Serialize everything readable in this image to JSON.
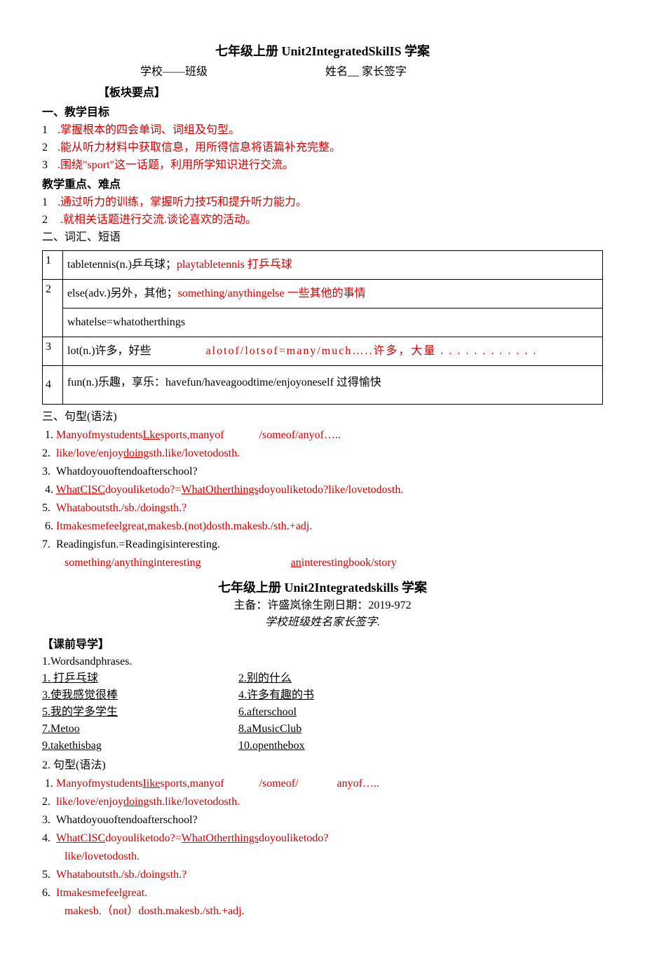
{
  "title1": "七年级上册 Unit2IntegratedSkilIS 学案",
  "header_line_left": "学校——班级",
  "header_line_right": "姓名__ 家长签字",
  "block_label": "【板块要点】",
  "sec1_head": "一、教学目标",
  "sec1_items": {
    "1": ".掌握根本的四会单词、词组及句型。",
    "2": ".能从听力材料中获取信息，用所得信息将语篇补充完整。",
    "3_a": ".围绕\"sport",
    "3_b": "\"这一话题，利用所学知识进行交流。"
  },
  "sec_diff_head": "教学重点、难点",
  "sec_diff_items": {
    "1": ".通过听力的训练，掌握听力技巧和提升听力能力。",
    "2": ".就相关话题进行交流.谈论喜欢的活动。"
  },
  "sec2_head": "二、词汇、短语",
  "vocab": {
    "r1": {
      "n": "1",
      "a": "tabletennis(n.)乒乓球；",
      "b": "playtabletennis 打乒乓球"
    },
    "r2_l1": {
      "n": "2",
      "a": "else(adv.)另外，其他；",
      "b": "something/anythingelse 一些其他的事情"
    },
    "r2_l2": "whatelse=whatotherthings",
    "r3": {
      "n": "3",
      "a": "lot(n.)许多，好些",
      "b": "alotof/lotsof=many/much…..许多，大量 . . . . . . . . . . . ."
    },
    "r4": {
      "n": "4",
      "txt": "fun(n.)乐趣，享乐：havefun/haveagoodtime/enjoyoneself 过得愉快"
    }
  },
  "sec3_head": "三、句型(语法)",
  "gram1": {
    "i1_a": "Manyofmystudents",
    "i1_b": "Lke",
    "i1_c": "sports,manyof",
    "i1_d": "/someof/anyof…..",
    "i2": "like/love/enjoy",
    "i2_u": "doing",
    "i2_c": "sth.like/lovetodosth.",
    "i3": "Whatdoyouoftendoafterschool?",
    "i4_a": "WhatCISC",
    "i4_b": "doyouliketodo?=",
    "i4_c": "WhatOtherthings",
    "i4_d": "doyouliketodo?like/lovetodosth.",
    "i5": "Whataboutsth./sb./doingsth.?",
    "i6": "Itmakesmefeelgreat,makesb.(not)dosth.makesb./sth.+adj.",
    "i7": "Readingisfun.=Readingisinteresting.",
    "i7_b": "something/anythinginteresting",
    "i7_c": "an",
    "i7_d": "interestingbook/story"
  },
  "title2": "七年级上册 Unit2Integratedskills 学案",
  "meta1": "主备：许盛岚徐生刚日期：2019-972",
  "meta2": "学校班级姓名家长签字.",
  "preclass_head": "【课前导学】",
  "wp_head": "1.Wordsandphrases.",
  "phrases": {
    "p1l": "1. 打乒乓球",
    "p1r": "2.别的什么",
    "p2l": "3.使我感觉很棒",
    "p2r": "4.许多有趣的书",
    "p3l": "5.我的学多学生",
    "p3r": "6.afterschool",
    "p4l": "7.Metoo",
    "p4r": "8.aMusicClub",
    "p5l": "9.takethisbag",
    "p5r": "10.openthebox"
  },
  "sec3b_head": "2. 句型(语法)",
  "gram2": {
    "i1_a": "Manyofmystudents",
    "i1_b": "Iike",
    "i1_c": "sports,manyof",
    "i1_d": "/someof/",
    "i1_e": "anyof…..",
    "i2": "like/love/enjoy",
    "i2_u": "doing",
    "i2_c": "sth.like/lovetodosth.",
    "i3": "Whatdoyouoftendoafterschool?",
    "i4_a": "WhatCISC",
    "i4_b": "doyouliketodo?=",
    "i4_c": "WhatOtherthings",
    "i4_d": "doyouliketodo?",
    "i4_e": "like/lovetodosth.",
    "i5": "Whataboutsth./sb./doingsth.?",
    "i6_a": "It",
    "i6_b": "makesmefeelgreat.",
    "i6_c": "makesb.（not）dosth.makesb./sth.+adj."
  }
}
